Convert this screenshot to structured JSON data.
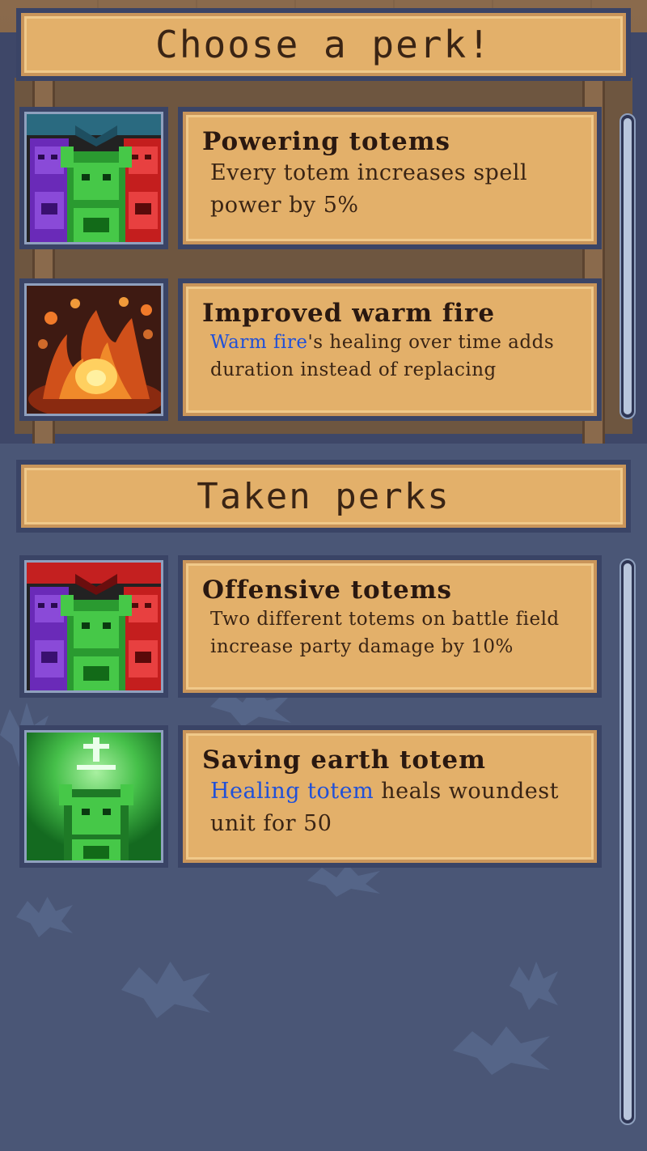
{
  "header": {
    "title": "Choose a perk!"
  },
  "available_perks": [
    {
      "title": "Powering totems",
      "description": "Every totem increases spell power by 5%",
      "icon": "three-totems-teal-icon"
    },
    {
      "title": "Improved warm fire",
      "description_highlight": "Warm fire",
      "description_rest": "'s healing over time adds duration instead of replacing",
      "icon": "warm-fire-icon"
    }
  ],
  "taken_section": {
    "title": "Taken perks"
  },
  "taken_perks": [
    {
      "title": "Offensive totems",
      "description": "Two different totems on battle field increase party damage by 10%",
      "icon": "three-totems-red-icon"
    },
    {
      "title": "Saving earth totem",
      "description_highlight": "Healing totem",
      "description_rest": " heals woundest unit for 50",
      "icon": "earth-totem-icon"
    }
  ],
  "colors": {
    "parchment": "#e3b06a",
    "frame": "#3a4466",
    "text": "#2a1810",
    "highlight": "#2050d8",
    "background": "#4a5676"
  }
}
